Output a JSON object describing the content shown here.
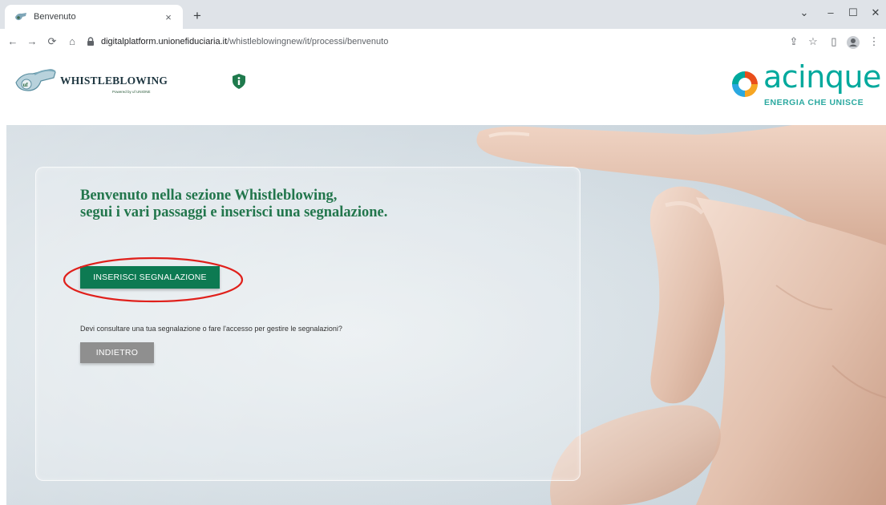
{
  "browser": {
    "tab_title": "Benvenuto",
    "tab_close": "×",
    "new_tab": "+",
    "url_host": "digitalplatform.unionefiduciaria.it",
    "url_path": "/whistleblowingnew/it/processi/benvenuto",
    "window_controls": {
      "minimize": "–",
      "maximize": "☐",
      "close": "✕",
      "dropdown": "⌄"
    }
  },
  "header": {
    "brand_name": "WHISTLEBLOWING",
    "powered_by": "Powered by uf UNIONE",
    "partner_name": "acinque",
    "partner_tagline": "ENERGIA CHE UNISCE"
  },
  "hero": {
    "title_line1": "Benvenuto nella sezione Whistleblowing,",
    "title_line2": "segui i vari passaggi e inserisci una segnalazione.",
    "primary_button": "INSERISCI SEGNALAZIONE",
    "prompt": "Devi consultare una tua segnalazione o fare l'accesso per gestire le segnalazioni?",
    "secondary_button": "INDIETRO"
  },
  "colors": {
    "brand_green": "#0d7a52",
    "title_green": "#22764c",
    "teal": "#00a99d",
    "highlight_red": "#e0201b",
    "secondary_grey": "#8f8f8f"
  }
}
